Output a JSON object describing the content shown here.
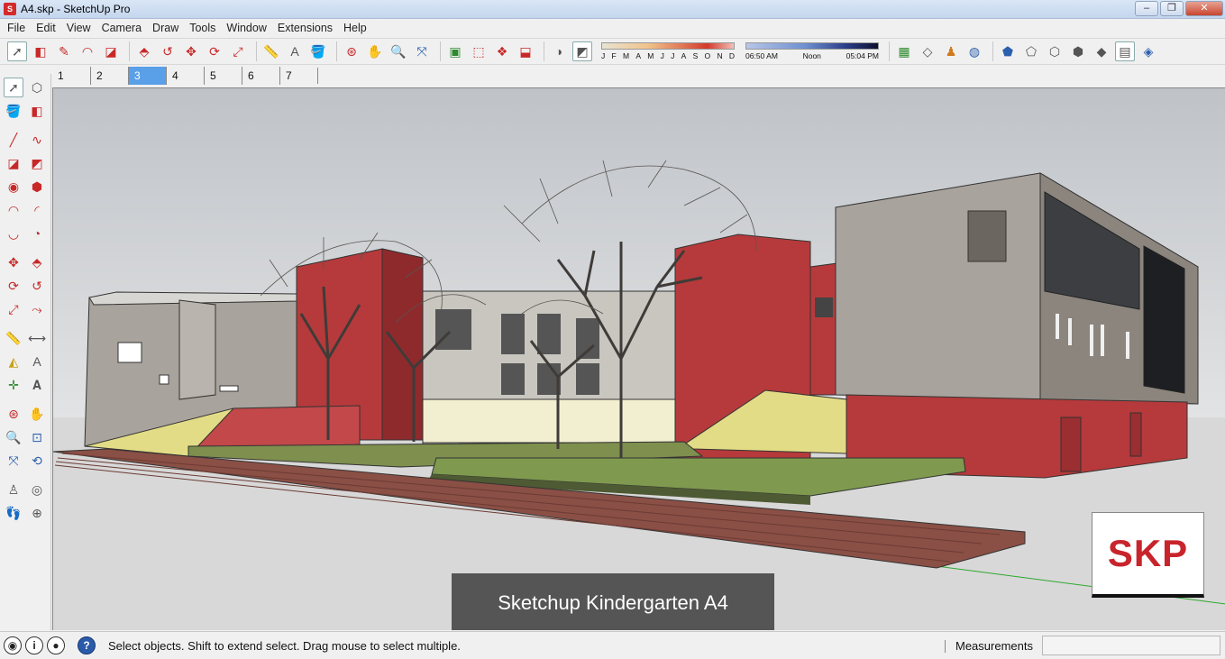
{
  "window": {
    "title": "A4.skp - SketchUp Pro",
    "app_icon": "sketchup-logo-icon",
    "minimize": "–",
    "maximize": "❐",
    "close": "✕"
  },
  "menu": [
    "File",
    "Edit",
    "View",
    "Camera",
    "Draw",
    "Tools",
    "Window",
    "Extensions",
    "Help"
  ],
  "shadow": {
    "months": [
      "J",
      "F",
      "M",
      "A",
      "M",
      "J",
      "J",
      "A",
      "S",
      "O",
      "N",
      "D"
    ],
    "time_start": "06:50 AM",
    "time_mid": "Noon",
    "time_end": "05:04 PM"
  },
  "scenes": {
    "tabs": [
      "1",
      "2",
      "3",
      "4",
      "5",
      "6",
      "7"
    ],
    "selected": "3"
  },
  "viewport": {
    "caption": "Sketchup Kindergarten A4",
    "logo_text": "SKP",
    "colors": {
      "sky": "#c9ccd1",
      "ground": "#d6d6d6",
      "red_wall": "#b8383a",
      "concrete": "#a9a39b"
    }
  },
  "status": {
    "message": "Select objects. Shift to extend select. Drag mouse to select multiple.",
    "measurements_label": "Measurements",
    "measurements_value": "",
    "info_glyph": "i",
    "help_glyph": "?",
    "geo_glyph": "◉",
    "user_glyph": "●"
  }
}
